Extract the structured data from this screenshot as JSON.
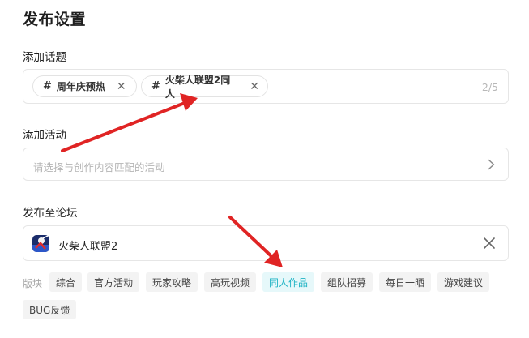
{
  "page": {
    "title": "发布设置"
  },
  "topics": {
    "label": "添加话题",
    "chips": [
      {
        "label": "周年庆预热"
      },
      {
        "label": "火柴人联盟2同人"
      }
    ],
    "counter": "2/5"
  },
  "activity": {
    "label": "添加活动",
    "placeholder": "请选择与创作内容匹配的活动"
  },
  "forum": {
    "label": "发布至论坛",
    "selected": "火柴人联盟2"
  },
  "categories": {
    "label": "版块",
    "items": [
      {
        "label": "综合",
        "active": false
      },
      {
        "label": "官方活动",
        "active": false
      },
      {
        "label": "玩家攻略",
        "active": false
      },
      {
        "label": "高玩视频",
        "active": false
      },
      {
        "label": "同人作品",
        "active": true
      },
      {
        "label": "组队招募",
        "active": false
      },
      {
        "label": "每日一晒",
        "active": false
      },
      {
        "label": "游戏建议",
        "active": false
      },
      {
        "label": "BUG反馈",
        "active": false
      }
    ]
  },
  "colors": {
    "accent": "#1fb3c4",
    "annotation_arrow": "#e02424"
  },
  "icons": [
    "hashtag-icon",
    "close-icon",
    "chevron-right-icon",
    "game-icon"
  ]
}
